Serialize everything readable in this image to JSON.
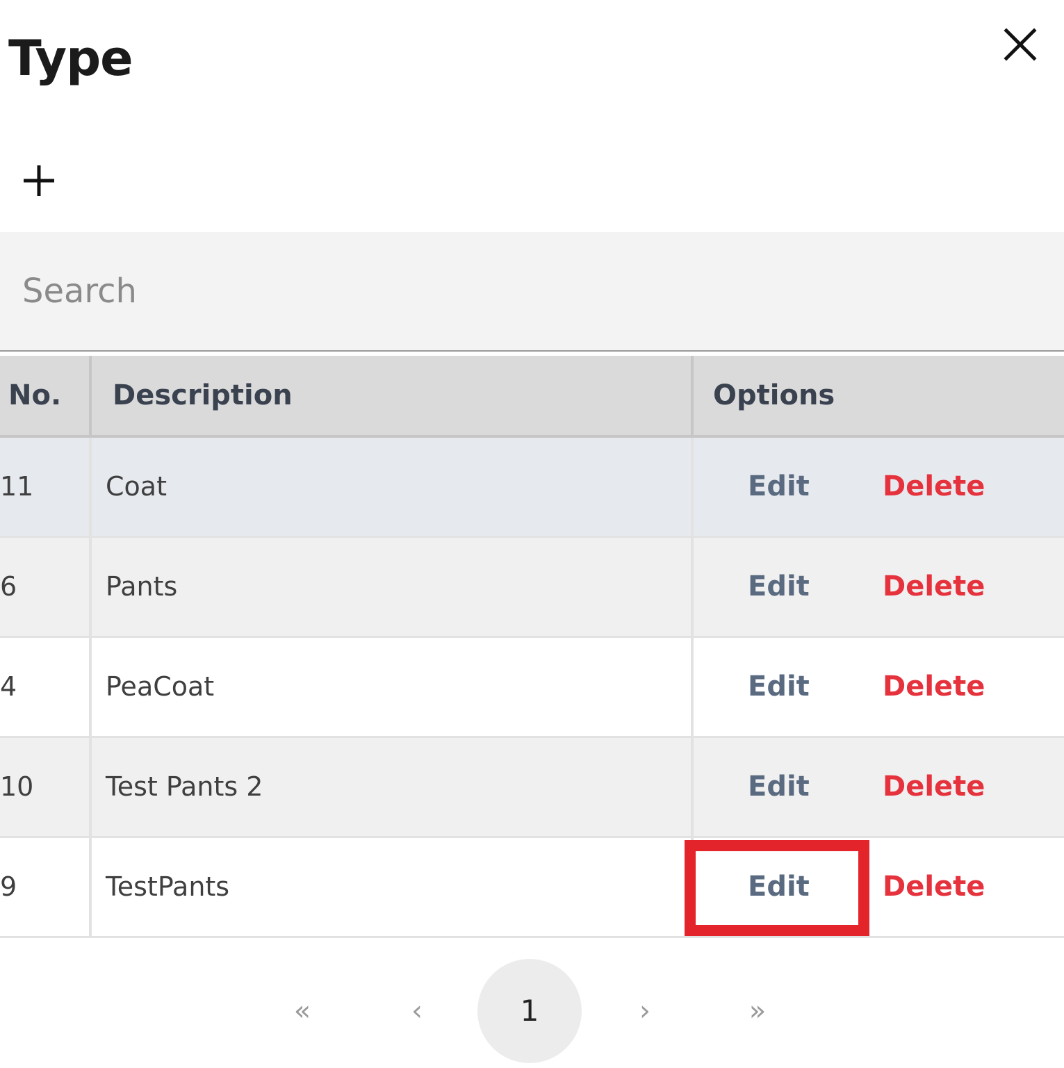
{
  "dialog": {
    "title": "Type"
  },
  "search": {
    "placeholder": "Search",
    "value": ""
  },
  "table": {
    "headers": {
      "no": "No.",
      "description": "Description",
      "options": "Options"
    },
    "rows": [
      {
        "no": "11",
        "description": "Coat",
        "edit": "Edit",
        "delete": "Delete"
      },
      {
        "no": "6",
        "description": "Pants",
        "edit": "Edit",
        "delete": "Delete"
      },
      {
        "no": "4",
        "description": "PeaCoat",
        "edit": "Edit",
        "delete": "Delete"
      },
      {
        "no": "10",
        "description": "Test Pants 2",
        "edit": "Edit",
        "delete": "Delete"
      },
      {
        "no": "9",
        "description": "TestPants",
        "edit": "Edit",
        "delete": "Delete"
      }
    ]
  },
  "pagination": {
    "first": "«",
    "prev": "‹",
    "current": "1",
    "next": "›",
    "last": "»"
  },
  "icons": {
    "close": "close-icon",
    "add": "plus-icon"
  },
  "colors": {
    "edit": "#5a6a80",
    "delete": "#e5323d",
    "highlight": "#e3242b",
    "header_bg": "#dadada",
    "search_bg": "#f3f3f3"
  }
}
